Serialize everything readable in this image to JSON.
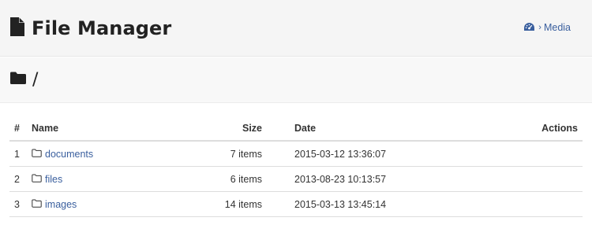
{
  "header": {
    "title": "File Manager",
    "breadcrumb": {
      "home_icon": "tachometer-icon",
      "separator": "›",
      "current": "Media"
    }
  },
  "path": {
    "icon": "folder-icon",
    "text": "/"
  },
  "table": {
    "columns": {
      "num": "#",
      "name": "Name",
      "size": "Size",
      "date": "Date",
      "actions": "Actions"
    },
    "rows": [
      {
        "num": "1",
        "name": "documents",
        "size": "7 items",
        "date": "2015-03-12 13:36:07"
      },
      {
        "num": "2",
        "name": "files",
        "size": "6 items",
        "date": "2013-08-23 10:13:57"
      },
      {
        "num": "3",
        "name": "images",
        "size": "14 items",
        "date": "2015-03-13 13:45:14"
      }
    ]
  },
  "colors": {
    "link": "#3a5f9e",
    "header_bg": "#f5f5f5",
    "text": "#333333"
  }
}
